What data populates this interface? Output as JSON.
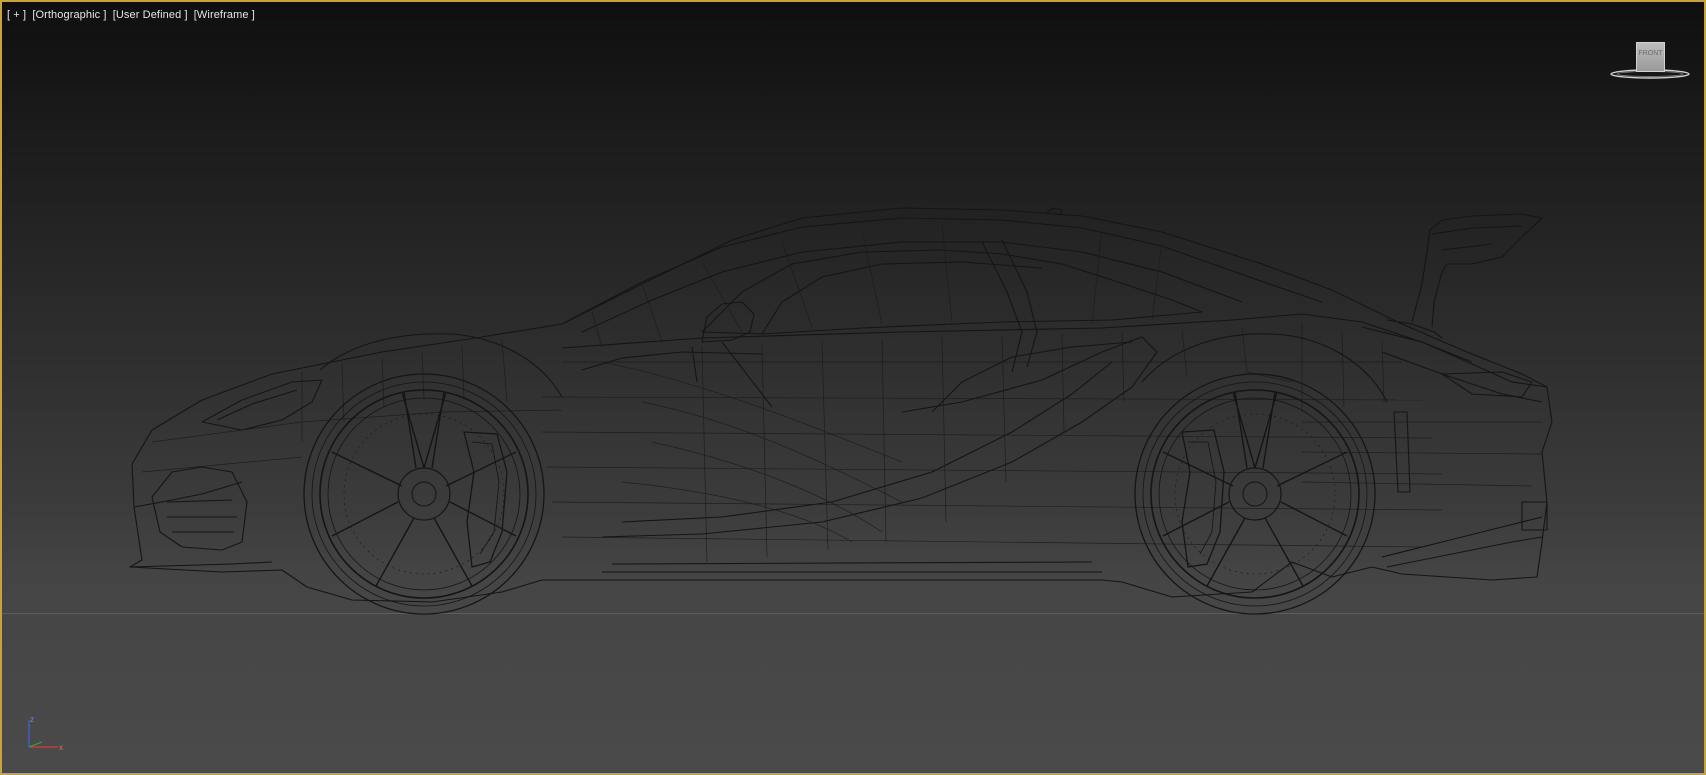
{
  "viewport": {
    "labels": [
      "[ + ]",
      "[Orthographic ]",
      "[User Defined ]",
      "[Wireframe ]"
    ],
    "active_border_color": "#c8a23a"
  },
  "viewcube": {
    "face_label": "FRONT",
    "icon": "viewcube-icon"
  },
  "axis_tripod": {
    "z_label": "z",
    "x_label": "x",
    "z_color": "#3a6ad8",
    "x_color": "#d83a3a"
  },
  "scene": {
    "object": "sports-car-wireframe",
    "wire_color": "#151515"
  }
}
